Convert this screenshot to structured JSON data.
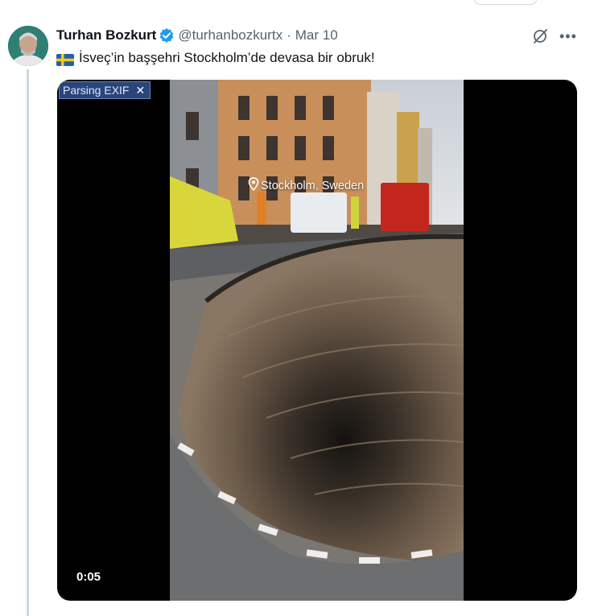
{
  "author": {
    "name": "Turhan Bozkurt",
    "handle": "@turhanbozkurtx",
    "separator": "·",
    "date": "Mar 10"
  },
  "tweet": {
    "flag_icon": "sweden-flag-icon",
    "text": "İsveç’in başşehri Stockholm’de devasa bir obruk!"
  },
  "header_actions": {
    "grok_icon": "grok-icon",
    "more_label": "•••"
  },
  "media": {
    "exif_badge": "Parsing EXIF",
    "exif_close": "✕",
    "location_overlay": "Stockholm, Sweden",
    "video_time": "0:05"
  },
  "colors": {
    "verified_blue": "#1d9bf0",
    "secondary_text": "#536471",
    "thread_line": "#cfd9de",
    "exif_bg": "#29457a"
  }
}
